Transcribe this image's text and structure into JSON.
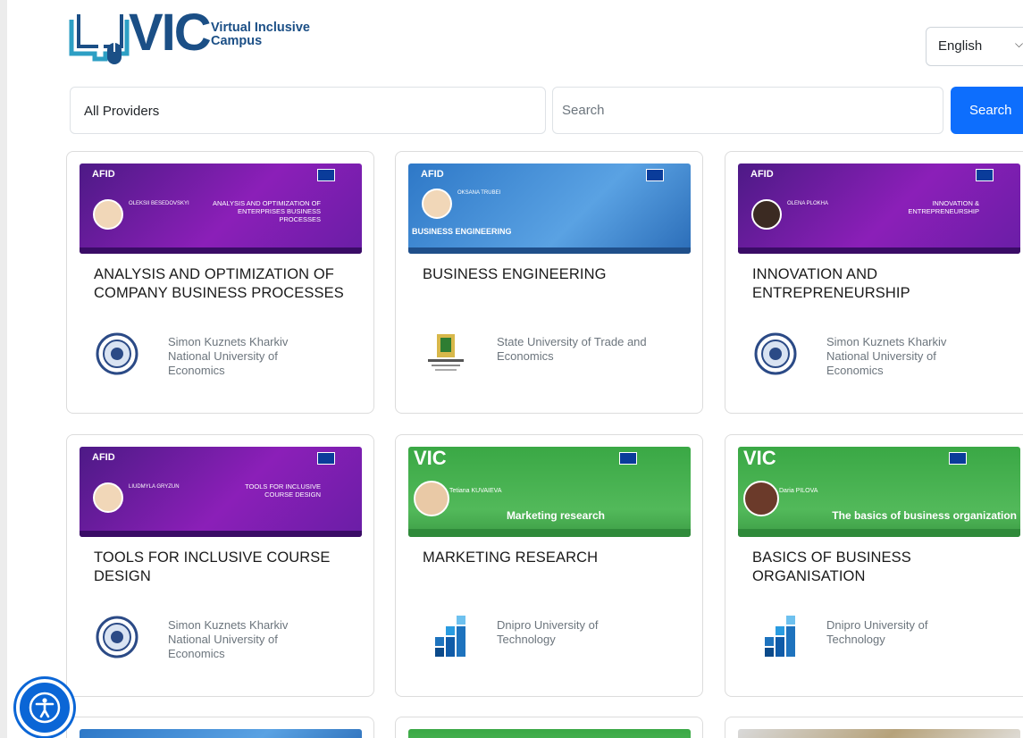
{
  "brand": {
    "logo_text": "VIC",
    "tagline_line1": "Virtual Inclusive",
    "tagline_line2": "Campus"
  },
  "language": {
    "selected": "English"
  },
  "filters": {
    "provider_selected": "All Providers",
    "search_placeholder": "Search",
    "search_button": "Search"
  },
  "courses": [
    {
      "title": "ANALYSIS AND OPTIMIZATION OF COMPANY BUSINESS PROCESSES",
      "provider": "Simon Kuznets Kharkiv National University of Economics",
      "banner": {
        "brand": "AFID",
        "person": "OLEKSII BESEDOVSKYI",
        "course_text": "ANALYSIS AND OPTIMIZATION OF ENTERPRISES BUSINESS PROCESSES"
      }
    },
    {
      "title": "BUSINESS ENGINEERING",
      "provider": "State University of Trade and Economics",
      "banner": {
        "brand": "AFID",
        "person": "OKSANA TRUBEI",
        "course_text": "BUSINESS ENGINEERING"
      }
    },
    {
      "title": "INNOVATION AND ENTREPRENEURSHIP",
      "provider": "Simon Kuznets Kharkiv National University of Economics",
      "banner": {
        "brand": "AFID",
        "person": "OLENA PLOKHA",
        "course_text": "INNOVATION & ENTREPRENEURSHIP"
      }
    },
    {
      "title": "TOOLS FOR INCLUSIVE COURSE DESIGN",
      "provider": "Simon Kuznets Kharkiv National University of Economics",
      "banner": {
        "brand": "AFID",
        "person": "LIUDMYLA GRYZUN",
        "course_text": "TOOLS FOR INCLUSIVE COURSE DESIGN"
      }
    },
    {
      "title": "MARKETING RESEARCH",
      "provider": "Dnipro University of Technology",
      "banner": {
        "brand": "VIC",
        "person": "Tetiana KUVAIEVA",
        "course_text": "Marketing research"
      }
    },
    {
      "title": "BASICS OF BUSINESS ORGANISATION",
      "provider": "Dnipro University of Technology",
      "banner": {
        "brand": "VIC",
        "person": "Daria PILOVA",
        "course_text": "The basics of business organization"
      }
    }
  ],
  "colors": {
    "primary": "#0d6efd",
    "brand_blue": "#1b4f86",
    "purple_banner": "#7a1fb0",
    "green_banner": "#45ad4f"
  }
}
